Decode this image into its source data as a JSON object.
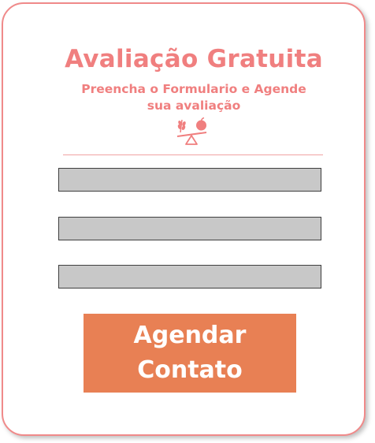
{
  "form": {
    "title": "Avaliação Gratuita",
    "subtitle_line1": "Preencha o Formulario e Agende",
    "subtitle_line2": "sua avaliação",
    "logo_icon": "wheat-apple-scale-icon",
    "fields": [
      {
        "name": "name-field",
        "value": "",
        "placeholder": ""
      },
      {
        "name": "email-field",
        "value": "",
        "placeholder": ""
      },
      {
        "name": "phone-field",
        "value": "",
        "placeholder": ""
      }
    ],
    "button_line1": "Agendar",
    "button_line2": "Contato"
  },
  "colors": {
    "accent_text": "#f07f7f",
    "card_border": "#f08a8a",
    "button_bg": "#e88054",
    "field_bg": "#c8c8c8",
    "field_border": "#3f3f3f"
  }
}
